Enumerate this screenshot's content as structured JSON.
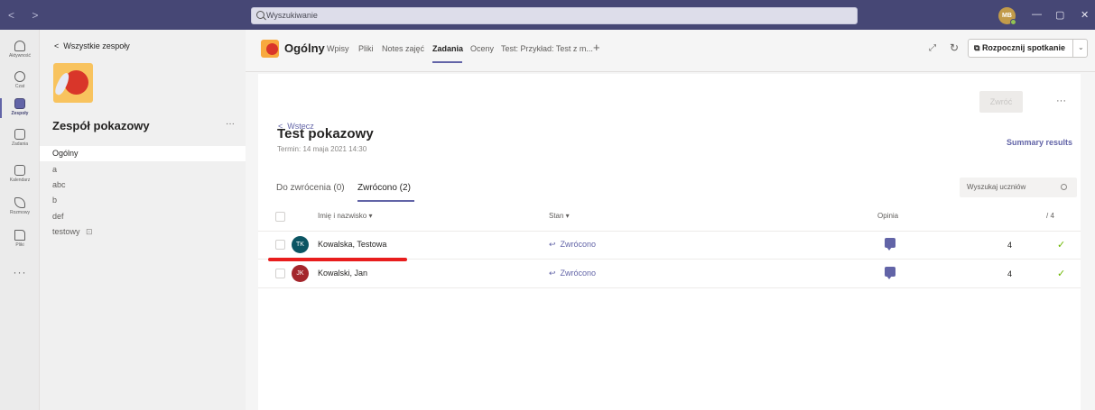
{
  "app": {
    "search_placeholder": "Wyszukiwanie",
    "user_initials": "MB",
    "window_controls": [
      "—",
      "▢",
      "✕"
    ]
  },
  "rail": {
    "items": [
      {
        "label": "Aktywność",
        "icon": "bell-icon"
      },
      {
        "label": "Czat",
        "icon": "chat-icon"
      },
      {
        "label": "Zespoły",
        "icon": "teams-icon",
        "active": true
      },
      {
        "label": "Zadania",
        "icon": "assignments-icon"
      },
      {
        "label": "Kalendarz",
        "icon": "calendar-icon"
      },
      {
        "label": "Rozmowy",
        "icon": "phone-icon"
      },
      {
        "label": "Pliki",
        "icon": "file-icon"
      }
    ],
    "more": "···"
  },
  "team_panel": {
    "back_label": "Wszystkie zespoły",
    "team_name": "Zespół pokazowy",
    "more": "···",
    "channels": [
      {
        "label": "Ogólny",
        "active": true
      },
      {
        "label": "a"
      },
      {
        "label": "abc"
      },
      {
        "label": "b"
      },
      {
        "label": "def"
      },
      {
        "label": "testowy"
      }
    ]
  },
  "header": {
    "channel_title": "Ogólny",
    "tabs": [
      "Wpisy",
      "Pliki",
      "Notes zajęć",
      "Zadania",
      "Oceny",
      "Test: Przykład: Test z m..."
    ],
    "active_tab": "Zadania",
    "add": "+",
    "meet_label": "Rozpocznij spotkanie"
  },
  "assignment": {
    "back": "Wstecz",
    "return_button": "Zwróć",
    "more": "···",
    "title": "Test pokazowy",
    "due": "Termin: 14 maja 2021 14:30",
    "summary_link": "Summary results",
    "tabs": {
      "to_return": "Do zwrócenia (0)",
      "returned": "Zwrócono (2)"
    },
    "search_placeholder": "Wyszukaj uczniów",
    "columns": {
      "name": "Imię i nazwisko ▾",
      "status": "Stan ▾",
      "feedback": "Opinia",
      "points": "/ 4"
    },
    "rows": [
      {
        "initials": "TK",
        "name": "Kowalska, Testowa",
        "avatar_color": "#0b5563",
        "status": "Zwrócono",
        "grade": "4"
      },
      {
        "initials": "JK",
        "name": "Kowalski, Jan",
        "avatar_color": "#a4262c",
        "status": "Zwrócono",
        "grade": "4"
      }
    ]
  },
  "colors": {
    "titlebar": "#464775",
    "accent": "#6264a7",
    "annotation_underline": "#e81d1d"
  }
}
